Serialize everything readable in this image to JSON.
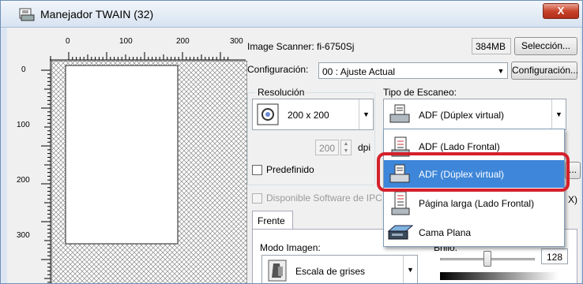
{
  "window": {
    "title": "Manejador TWAIN (32)",
    "close_label": "X"
  },
  "ruler": {
    "h_labels": [
      "0",
      "100",
      "200",
      "300"
    ],
    "v_labels": [
      "0",
      "100",
      "200",
      "300"
    ]
  },
  "scanner": {
    "label": "Image Scanner: fi-6750Sj",
    "memory": "384MB",
    "select_button": "Selección..."
  },
  "config": {
    "label": "Configuración:",
    "value": "00 : Ajuste Actual",
    "button": "Configuración..."
  },
  "resolution": {
    "group_label": "Resolución",
    "value": "200 x 200",
    "dpi_value": "200",
    "dpi_unit": "dpi",
    "predefined_label": "Predefinido",
    "predefined_checked": false
  },
  "scan_type": {
    "group_label": "Tipo de Escaneo:",
    "value": "ADF (Dúplex virtual)",
    "options": [
      {
        "label": "ADF (Lado Frontal)",
        "icon": "adf-front-icon",
        "selected": false
      },
      {
        "label": "ADF (Dúplex virtual)",
        "icon": "adf-duplex-icon",
        "selected": true
      },
      {
        "label": "Página larga (Lado Frontal)",
        "icon": "long-page-icon",
        "selected": false
      },
      {
        "label": "Cama Plana",
        "icon": "flatbed-icon",
        "selected": false
      }
    ],
    "right_stub_button": "...",
    "right_stub_text": "X)"
  },
  "ipc": {
    "label": "Disponible  Software de IPC"
  },
  "tabs": {
    "front": "Frente"
  },
  "image_mode": {
    "label": "Modo Imagen:",
    "value": "Escala de grises"
  },
  "brightness": {
    "label": "Brillo:",
    "value": "128",
    "level": 0.5
  },
  "colors": {
    "titlebar": "#d7e3f1",
    "selection": "#3d86d9",
    "highlight": "#d4202b",
    "close": "#c8442b"
  }
}
